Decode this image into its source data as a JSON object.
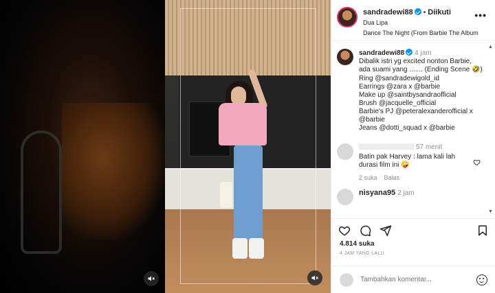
{
  "post": {
    "username": "sandradewi88",
    "follow_status": "Diikuti",
    "music_artist": "Dua Lipa",
    "music_title": "Dance The Night (From Barbie The Album",
    "more_label": "•••"
  },
  "caption": {
    "username": "sandradewi88",
    "time": "4 jam",
    "lines": [
      "Dibalik istri yg excited nonton Barbie,",
      "ada suami yang ....... (Ending Scene 🤣)",
      "Ring @sandradewigold_id",
      "Earrings @zara x @barbie",
      "Make up @saintbysandraofficial",
      "Brush @jacquelle_official",
      "Barbie's PJ @peteralexanderofficial x",
      "@barbie",
      "Jeans @dotti_squad x @barbie"
    ]
  },
  "comments": [
    {
      "username": "",
      "time": "57 menit",
      "text_line1": "Batin pak Harvey : lama kali lah",
      "text_line2": "durasi film ini 🤪",
      "likes": "2 suka",
      "reply_label": "Balas"
    },
    {
      "username": "nisyana95",
      "time": "2 jam"
    }
  ],
  "stats": {
    "likes": "4.814 suka",
    "time_ago": "4 JAM YANG LALU"
  },
  "composer": {
    "placeholder": "Tambahkan komentar..."
  },
  "icons": [
    "heart-icon",
    "comment-icon",
    "share-icon",
    "bookmark-icon",
    "mute-icon",
    "emoji-icon",
    "more-icon",
    "verified-icon"
  ],
  "colors": {
    "verified": "#0095f6",
    "text": "#262626",
    "muted": "#8e8e8e",
    "divider": "#efefef"
  }
}
